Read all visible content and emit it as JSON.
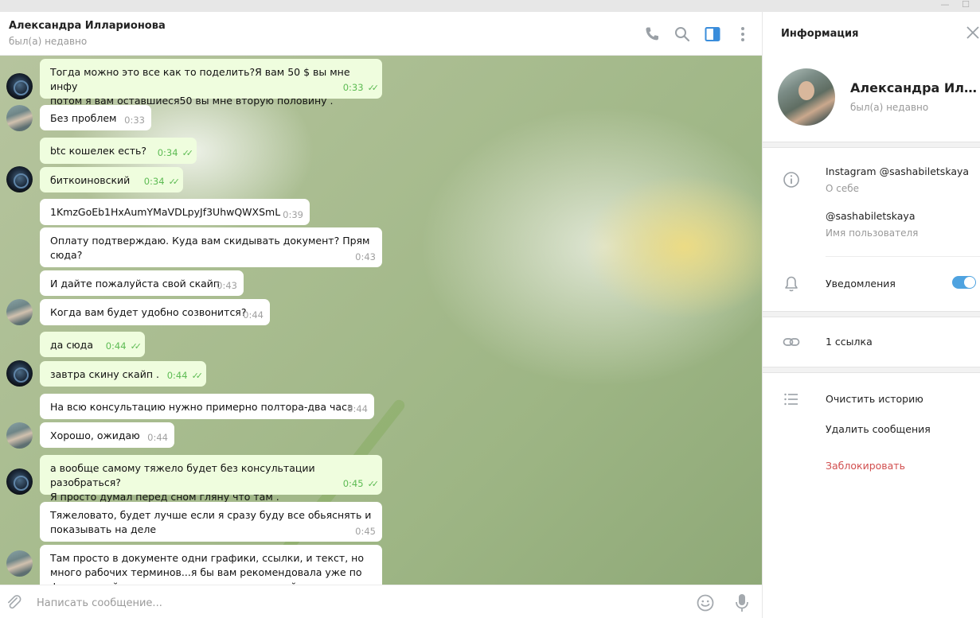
{
  "window": {
    "minimize_glyph": "—",
    "maximize_glyph": "☐"
  },
  "header": {
    "title": "Александра Илларионова",
    "status": "был(а) недавно",
    "icons": [
      "phone-icon",
      "search-icon",
      "info-panel-icon",
      "more-icon"
    ]
  },
  "messages": [
    {
      "dir": "out",
      "text": "Тогда можно это все как то поделить?Я вам 50 $ вы мне инфу\nпотом я вам оставшиеся50 вы мне вторую половину .",
      "time": "0:33",
      "read": true,
      "avatar": "me"
    },
    {
      "dir": "in",
      "text": "Без проблем",
      "time": "0:33",
      "avatar": "her"
    },
    {
      "dir": "out",
      "text": "btc кошелек есть?",
      "time": "0:34",
      "read": true
    },
    {
      "dir": "out",
      "text": "биткоиновский",
      "time": "0:34",
      "read": true,
      "avatar": "me"
    },
    {
      "dir": "in",
      "text": "1KmzGoEb1HxAumYMaVDLpyJf3UhwQWXSmL",
      "time": "0:39"
    },
    {
      "dir": "in",
      "text": "Оплату подтверждаю. Куда вам скидывать документ? Прям\nсюда?",
      "time": "0:43"
    },
    {
      "dir": "in",
      "text": "И дайте пожалуйста свой скайп",
      "time": "0:43"
    },
    {
      "dir": "in",
      "text": "Когда вам будет удобно созвонится?",
      "time": "0:44",
      "avatar": "her"
    },
    {
      "dir": "out",
      "text": "да сюда",
      "time": "0:44",
      "read": true
    },
    {
      "dir": "out",
      "text": "завтра скину скайп .",
      "time": "0:44",
      "read": true,
      "avatar": "me"
    },
    {
      "dir": "in",
      "text": "На всю консультацию нужно примерно полтора-два часа",
      "time": "0:44"
    },
    {
      "dir": "in",
      "text": "Хорошо, ожидаю",
      "time": "0:44",
      "avatar": "her"
    },
    {
      "dir": "out",
      "text": "а вообще самому тяжело будет без консультации разобраться?\nЯ просто думал перед сном гляну что там .",
      "time": "0:45",
      "read": true,
      "avatar": "me"
    },
    {
      "dir": "in",
      "text": "Тяжеловато, будет лучше если я сразу буду все обьяснять и\nпоказывать на деле",
      "time": "0:45"
    },
    {
      "dir": "in",
      "text": "Там просто в документе одни графики, ссылки, и текст, но\nмного рабочих терминов...я бы вам рекомендовала уже по\nфакту в скайпе законспектировать их со мной вместе",
      "time": "",
      "avatar": "her"
    }
  ],
  "composer": {
    "placeholder": "Написать сообщение...",
    "icons": [
      "attach-icon",
      "emoji-icon",
      "microphone-icon"
    ]
  },
  "info_panel": {
    "title": "Информация",
    "name": "Александра Илларионова",
    "status": "был(а) недавно",
    "bio": "Instagram @sashabiletskaya",
    "bio_label": "О себе",
    "username": "@sashabiletskaya",
    "username_label": "Имя пользователя",
    "notifications_label": "Уведомления",
    "notifications_on": true,
    "links_label": "1 ссылка",
    "clear_history": "Очистить историю",
    "delete_messages": "Удалить сообщения",
    "block": "Заблокировать"
  },
  "colors": {
    "accent": "#4fa3e0",
    "outgoing_bubble": "#effdde",
    "incoming_bubble": "#ffffff",
    "read_check": "#5dbb53",
    "danger": "#d14e4e"
  }
}
